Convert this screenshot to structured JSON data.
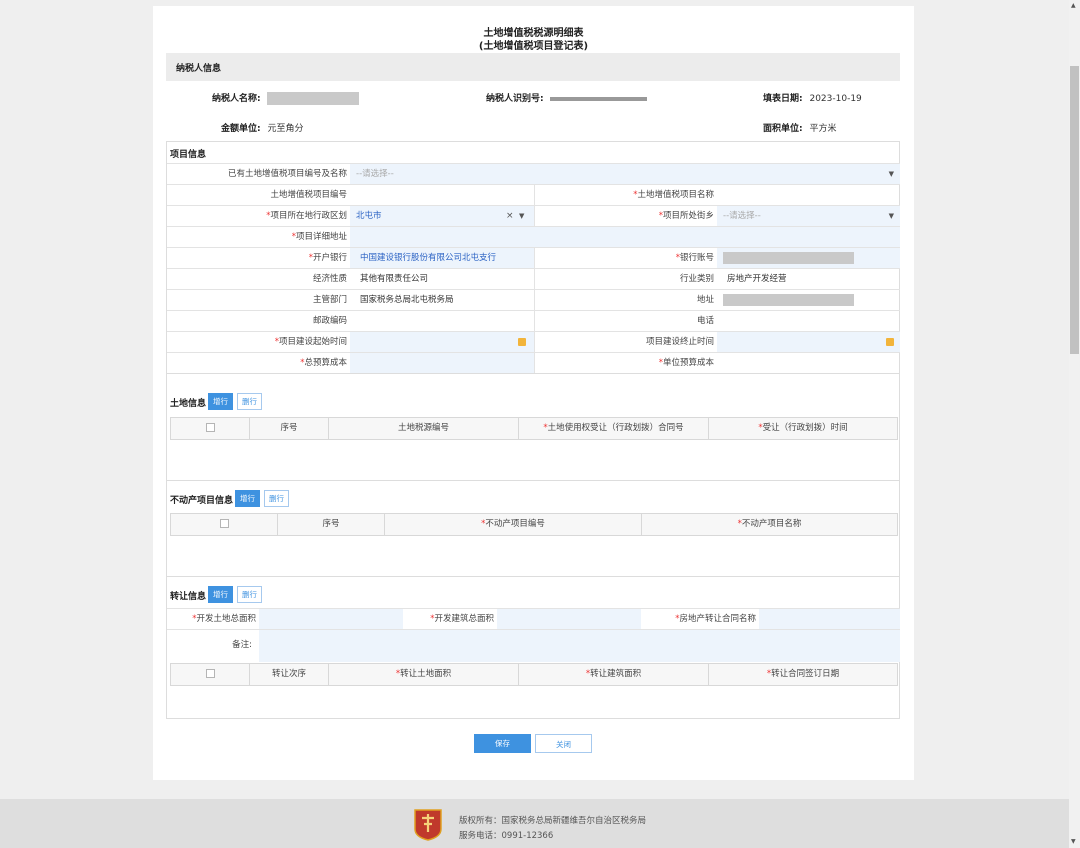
{
  "header": {
    "title": "土地增值税税源明细表",
    "subtitle": "(土地增值税项目登记表)"
  },
  "taxpayer": {
    "section": "纳税人信息",
    "name_label": "纳税人名称:",
    "id_label": "纳税人识别号:",
    "fill_date_label": "填表日期:",
    "fill_date": "2023-10-19",
    "amount_unit_label": "金额单位:",
    "amount_unit": "元至角分",
    "area_unit_label": "面积单位:",
    "area_unit": "平方米"
  },
  "project": {
    "section": "项目信息",
    "existing_label": "已有土地增值税项目编号及名称",
    "existing_placeholder": "--请选择--",
    "code_label": "土地增值税项目编号",
    "name_label": "土地增值税项目名称",
    "district_label": "项目所在地行政区划",
    "district_value": "北屯市",
    "street_label": "项目所处街乡",
    "street_placeholder": "--请选择--",
    "address_label": "项目详细地址",
    "bank_label": "开户银行",
    "bank_value": "中国建设银行股份有限公司北屯支行",
    "account_label": "银行账号",
    "economy_label": "经济性质",
    "economy_value": "其他有限责任公司",
    "industry_label": "行业类别",
    "industry_value": "房地产开发经营",
    "authority_label": "主管部门",
    "authority_value": "国家税务总局北屯税务局",
    "addr_label": "地址",
    "postcode_label": "邮政编码",
    "phone_label": "电话",
    "start_label": "项目建设起始时间",
    "end_label": "项目建设终止时间",
    "budget_label": "总预算成本",
    "unit_budget_label": "单位预算成本",
    "clear_mark": "×"
  },
  "land": {
    "section": "土地信息",
    "add": "增行",
    "del": "删行",
    "columns": [
      "序号",
      "土地税源编号",
      "土地使用权受让（行政划拨）合同号",
      "受让（行政划拨）时间"
    ]
  },
  "realestate": {
    "section": "不动产项目信息",
    "add": "增行",
    "del": "删行",
    "columns": [
      "序号",
      "不动产项目编号",
      "不动产项目名称"
    ]
  },
  "transfer": {
    "section": "转让信息",
    "add": "增行",
    "del": "删行",
    "land_area_label": "开发土地总面积",
    "build_area_label": "开发建筑总面积",
    "contract_label": "房地产转让合同名称",
    "remark_label": "备注:",
    "columns": [
      "转让次序",
      "转让土地面积",
      "转让建筑面积",
      "转让合同签订日期"
    ]
  },
  "actions": {
    "save": "保存",
    "close": "关闭"
  },
  "footer": {
    "copyright": "版权所有：国家税务总局新疆维吾尔自治区税务局",
    "hotline": "服务电话：0991-12366",
    "logo_text": "中国税务"
  },
  "colors": {
    "accent": "#3e92e0",
    "required": "#e33333",
    "input_bg": "#edf4fc"
  }
}
